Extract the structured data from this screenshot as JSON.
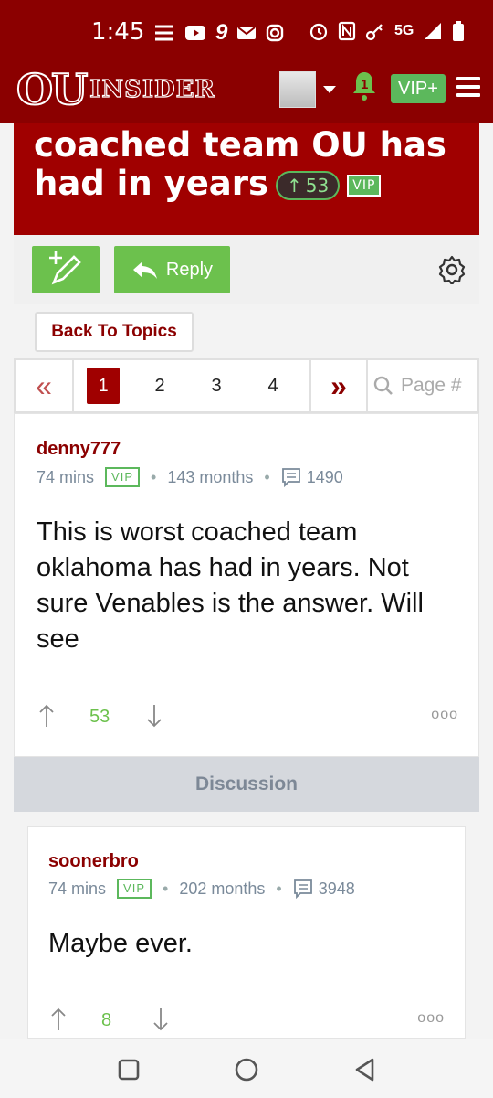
{
  "status_bar": {
    "time": "1:45",
    "network": "5G"
  },
  "header": {
    "logo_ou": "OU",
    "logo_insider": "INSIDER",
    "notification_count": "1",
    "vip_label": "VIP+"
  },
  "thread": {
    "title": "This is the worst coached team OU has had in years",
    "votes": "53",
    "vip_tag": "VIP"
  },
  "toolbar": {
    "reply_label": "Reply",
    "back_label": "Back To Topics"
  },
  "pagination": {
    "pages": [
      "1",
      "2",
      "3",
      "4"
    ],
    "current": "1",
    "search_placeholder": "Page #"
  },
  "post": {
    "username": "denny777",
    "time": "74 mins",
    "badge": "VIP",
    "tenure": "143 months",
    "post_count": "1490",
    "text": "This is worst coached team oklahoma has had in years. Not sure Venables is the answer. Will see",
    "votes": "53",
    "more": "ooo"
  },
  "discussion_label": "Discussion",
  "reply": {
    "username": "soonerbro",
    "time": "74 mins",
    "badge": "VIP",
    "tenure": "202 months",
    "post_count": "3948",
    "text": "Maybe ever.",
    "votes": "8",
    "more": "ooo"
  },
  "colors": {
    "brand": "#8b0000",
    "accent_green": "#6cc14d",
    "meta_gray": "#7a8a9a"
  }
}
